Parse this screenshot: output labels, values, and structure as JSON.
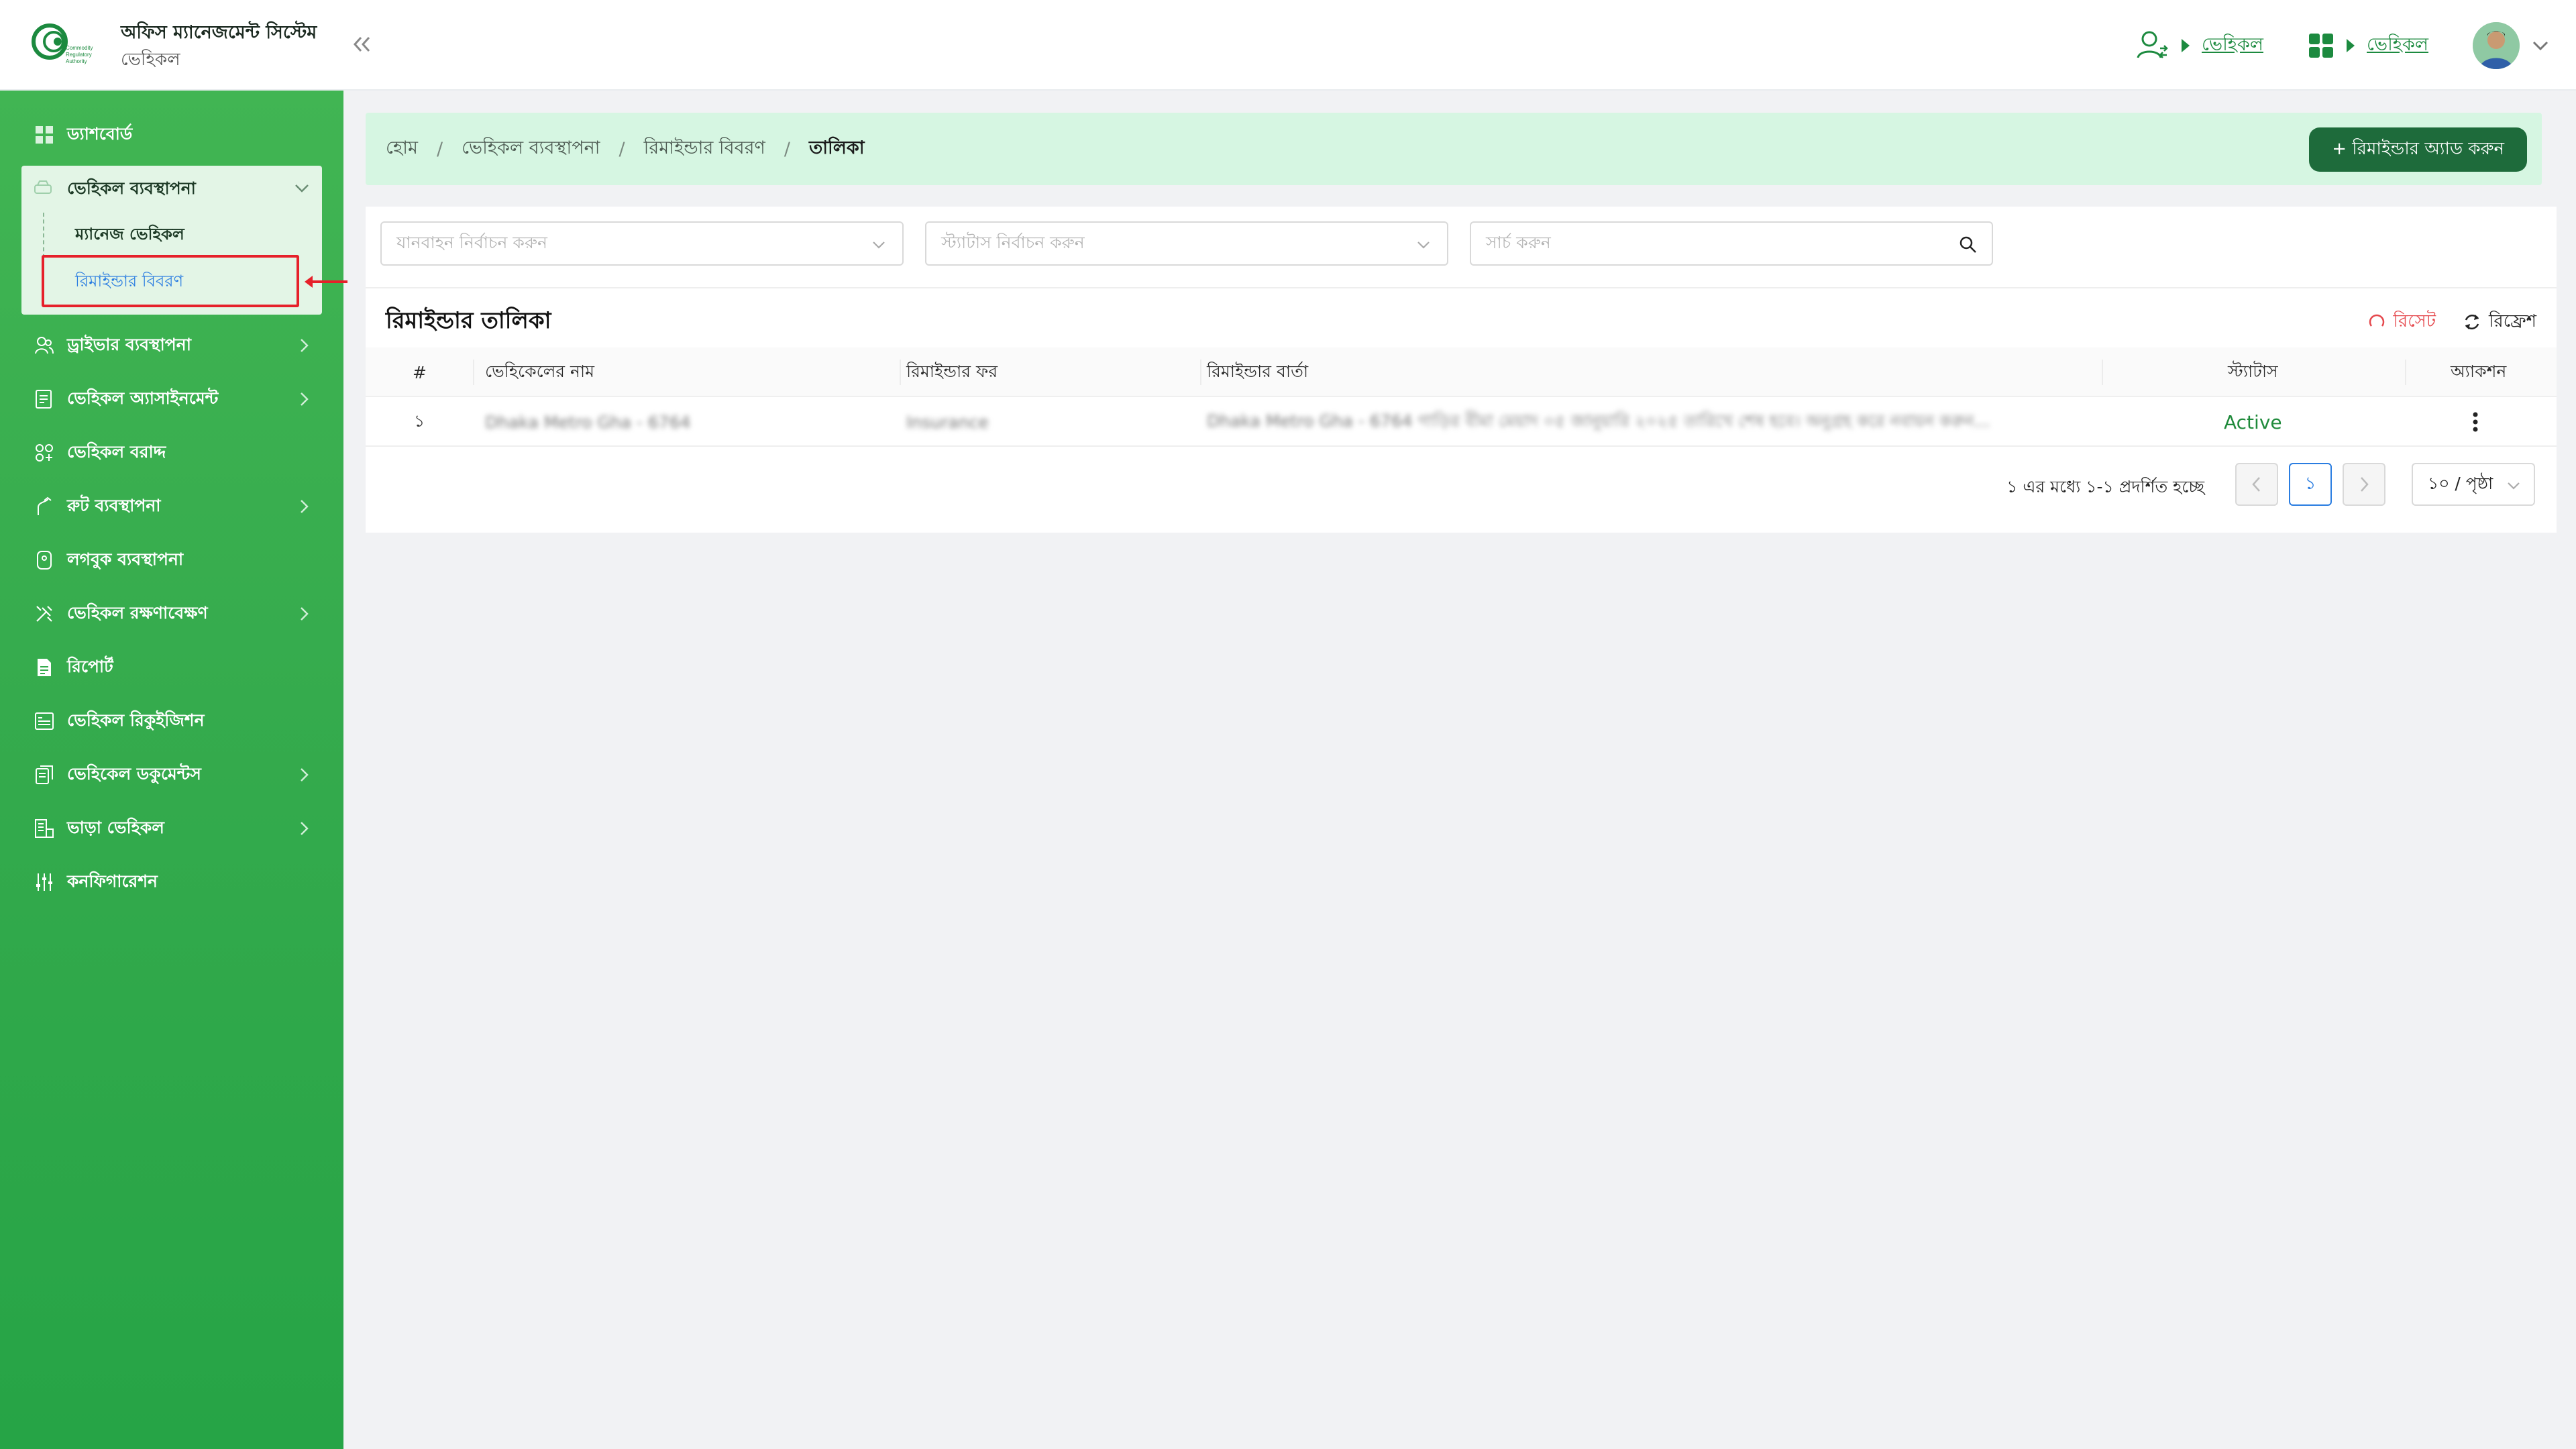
{
  "header": {
    "title": "অফিস ম্যানেজমেন্ট সিস্টেম",
    "subtitle": "ভেহিকল",
    "links": [
      "ভেহিকল",
      "ভেহিকল"
    ],
    "logo_text": [
      "Commodity",
      "Regulatory",
      "Authority"
    ]
  },
  "sidebar": {
    "items": [
      {
        "label": "ড্যাশবোর্ড",
        "icon": "grid-icon"
      },
      {
        "label": "ভেহিকল ব্যবস্থাপনা",
        "icon": "car-icon",
        "expanded": true,
        "children": [
          "ম্যানেজ ভেহিকল",
          "রিমাইন্ডার বিবরণ"
        ]
      },
      {
        "label": "ড্রাইভার ব্যবস্থাপনা",
        "icon": "users-icon"
      },
      {
        "label": "ভেহিকল অ্যাসাইনমেন্ট",
        "icon": "document-icon"
      },
      {
        "label": "ভেহিকল বরাদ্দ",
        "icon": "nodes-icon"
      },
      {
        "label": "রুট ব্যবস্থাপনা",
        "icon": "route-icon"
      },
      {
        "label": "লগবুক ব্যবস্থাপনা",
        "icon": "logbook-icon"
      },
      {
        "label": "ভেহিকল রক্ষণাবেক্ষণ",
        "icon": "tools-icon"
      },
      {
        "label": "রিপোর্ট",
        "icon": "report-icon"
      },
      {
        "label": "ভেহিকল রিকুইজিশন",
        "icon": "requisition-icon"
      },
      {
        "label": "ভেহিকেল ডকুমেন্টস",
        "icon": "documents-icon"
      },
      {
        "label": "ভাড়া ভেহিকল",
        "icon": "rent-icon"
      },
      {
        "label": "কনফিগারেশন",
        "icon": "sliders-icon"
      }
    ]
  },
  "breadcrumb": [
    "হোম",
    "ভেহিকল ব্যবস্থাপনা",
    "রিমাইন্ডার বিবরণ",
    "তালিকা"
  ],
  "add_button": "+ রিমাইন্ডার অ্যাড করুন",
  "filters": {
    "vehicle_placeholder": "যানবাহন নির্বাচন করুন",
    "status_placeholder": "স্ট্যাটাস নির্বাচন করুন",
    "search_placeholder": "সার্চ করুন"
  },
  "list": {
    "title": "রিমাইন্ডার তালিকা",
    "reset": "রিসেট",
    "refresh": "রিফ্রেশ"
  },
  "table": {
    "columns": [
      "#",
      "ভেহিকেলের নাম",
      "রিমাইন্ডার ফর",
      "রিমাইন্ডার বার্তা",
      "স্ট্যাটাস",
      "অ্যাকশন"
    ],
    "rows": [
      {
        "index": "১",
        "vehicle": "Dhaka Metro Gha - 6764",
        "for": "Insurance",
        "message": "Dhaka Metro Gha - 6764 গাড়ির বীমা মেয়াদ ০৫ জানুয়ারি ২০২৫ তারিখে শেষ হবে। অনুগ্রহ করে নবায়ন করুন...",
        "status": "Active"
      }
    ]
  },
  "pagination": {
    "summary": "১ এর মধ্যে ১-১ প্রদর্শিত হচ্ছে",
    "current_page": "১",
    "page_size": "১০ / পৃষ্ঠা"
  },
  "colors": {
    "sidebar": "#35ab4d",
    "accent": "#1e6b3b",
    "breadcrumb_bg": "#d6f6e2",
    "active_status": "#1f8a3b",
    "highlight": "#e6202a"
  }
}
